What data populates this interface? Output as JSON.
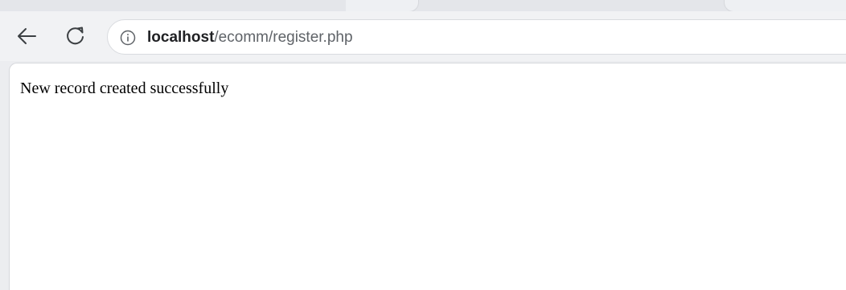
{
  "browser": {
    "url": {
      "host": "localhost",
      "path": "/ecomm/register.php"
    },
    "icons": {
      "back": "arrow-left-icon",
      "reload": "reload-icon",
      "site_info": "info-circle-icon"
    }
  },
  "page": {
    "message": "New record created successfully"
  },
  "colors": {
    "toolbar_bg": "#f1f2f4",
    "icon": "#3c4043",
    "url_host": "#202124",
    "url_path": "#5f6368",
    "content_bg": "#ffffff"
  }
}
